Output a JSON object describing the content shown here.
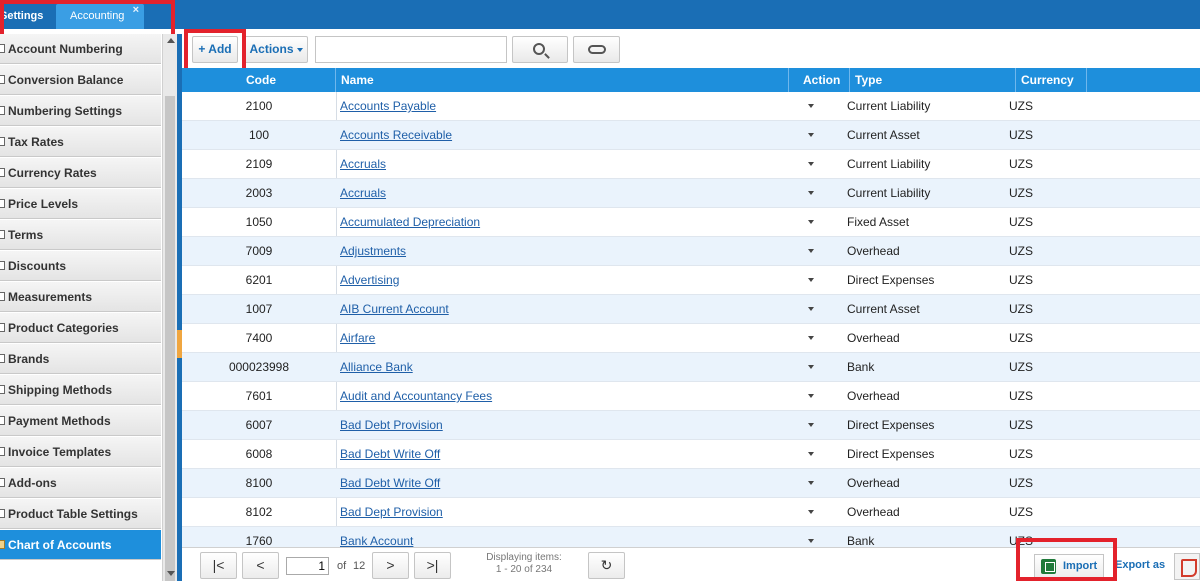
{
  "tabs": [
    {
      "label": "Settings"
    },
    {
      "label": "Accounting",
      "close": "×"
    }
  ],
  "sidebar": {
    "items": [
      {
        "label": "Account Numbering"
      },
      {
        "label": "Conversion Balance"
      },
      {
        "label": "Numbering Settings"
      },
      {
        "label": "Tax Rates"
      },
      {
        "label": "Currency Rates"
      },
      {
        "label": "Price Levels"
      },
      {
        "label": "Terms"
      },
      {
        "label": "Discounts"
      },
      {
        "label": "Measurements"
      },
      {
        "label": "Product Categories"
      },
      {
        "label": "Brands"
      },
      {
        "label": "Shipping Methods"
      },
      {
        "label": "Payment Methods"
      },
      {
        "label": "Invoice Templates"
      },
      {
        "label": "Add-ons"
      },
      {
        "label": "Product Table Settings"
      },
      {
        "label": "Chart of Accounts"
      }
    ],
    "active": "Chart of Accounts"
  },
  "toolbar": {
    "add_label": "+ Add",
    "actions_label": "Actions",
    "search_value": "",
    "search_icon": "search-icon",
    "reset_icon": "link-icon"
  },
  "grid": {
    "columns": [
      "Code",
      "Name",
      "Action",
      "Type",
      "Currency"
    ],
    "rows": [
      {
        "code": "2100",
        "name": "Accounts Payable",
        "type": "Current Liability",
        "currency": "UZS"
      },
      {
        "code": "100",
        "name": "Accounts Receivable",
        "type": "Current Asset",
        "currency": "UZS"
      },
      {
        "code": "2109",
        "name": "Accruals",
        "type": "Current Liability",
        "currency": "UZS"
      },
      {
        "code": "2003",
        "name": "Accruals",
        "type": "Current Liability",
        "currency": "UZS"
      },
      {
        "code": "1050",
        "name": "Accumulated Depreciation",
        "type": "Fixed Asset",
        "currency": "UZS"
      },
      {
        "code": "7009",
        "name": "Adjustments",
        "type": "Overhead",
        "currency": "UZS"
      },
      {
        "code": "6201",
        "name": "Advertising",
        "type": "Direct Expenses",
        "currency": "UZS"
      },
      {
        "code": "1007",
        "name": "AIB Current Account",
        "type": "Current Asset",
        "currency": "UZS"
      },
      {
        "code": "7400",
        "name": "Airfare",
        "type": "Overhead",
        "currency": "UZS"
      },
      {
        "code": "000023998",
        "name": "Alliance Bank",
        "type": "Bank",
        "currency": "UZS"
      },
      {
        "code": "7601",
        "name": "Audit and Accountancy Fees",
        "type": "Overhead",
        "currency": "UZS"
      },
      {
        "code": "6007",
        "name": "Bad Debt Provision",
        "type": "Direct Expenses",
        "currency": "UZS"
      },
      {
        "code": "6008",
        "name": "Bad Debt Write Off",
        "type": "Direct Expenses",
        "currency": "UZS"
      },
      {
        "code": "8100",
        "name": "Bad Debt Write Off",
        "type": "Overhead",
        "currency": "UZS"
      },
      {
        "code": "8102",
        "name": "Bad Dept Provision",
        "type": "Overhead",
        "currency": "UZS"
      },
      {
        "code": "1760",
        "name": "Bank Account",
        "type": "Bank",
        "currency": "UZS"
      }
    ]
  },
  "pager": {
    "page": "1",
    "of_label": "of",
    "total_pages": "12",
    "displaying_label": "Displaying items:",
    "range": "1 - 20 of 234"
  },
  "footer": {
    "import_label": "Import",
    "export_label": "Export as"
  },
  "colors": {
    "brand": "#1a6eb5",
    "header": "#1e8fdc",
    "highlight": "#e3222c"
  }
}
